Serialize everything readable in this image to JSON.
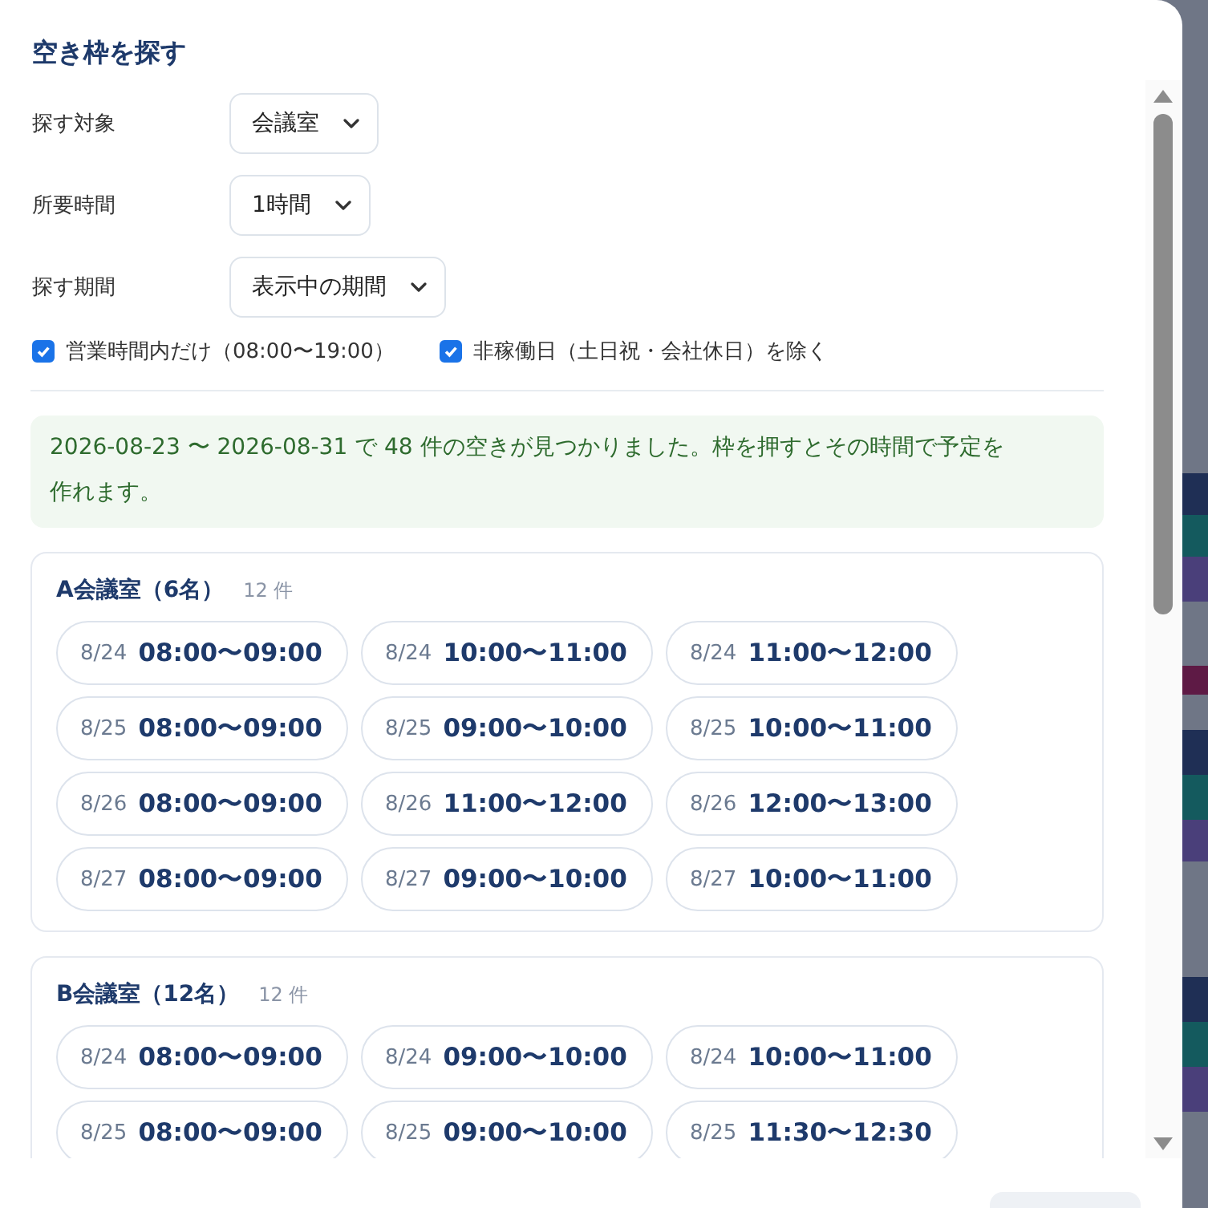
{
  "dialog": {
    "title": "空き枠を探す",
    "fields": [
      {
        "label": "探す対象",
        "value": "会議室"
      },
      {
        "label": "所要時間",
        "value": "1時間"
      },
      {
        "label": "探す期間",
        "value": "表示中の期間"
      }
    ],
    "checkboxes": [
      {
        "label": "営業時間内だけ（08:00〜19:00）",
        "checked": true
      },
      {
        "label": "非稼働日（土日祝・会社休日）を除く",
        "checked": true
      }
    ],
    "notice": "2026-08-23 〜 2026-08-31 で 48 件の空きが見つかりました。枠を押すとその時間で予定を作れます。",
    "groups": [
      {
        "name": "A会議室（6名）",
        "count": "12 件",
        "slots": [
          {
            "date": "8/24",
            "time": "08:00〜09:00"
          },
          {
            "date": "8/24",
            "time": "10:00〜11:00"
          },
          {
            "date": "8/24",
            "time": "11:00〜12:00"
          },
          {
            "date": "8/25",
            "time": "08:00〜09:00"
          },
          {
            "date": "8/25",
            "time": "09:00〜10:00"
          },
          {
            "date": "8/25",
            "time": "10:00〜11:00"
          },
          {
            "date": "8/26",
            "time": "08:00〜09:00"
          },
          {
            "date": "8/26",
            "time": "11:00〜12:00"
          },
          {
            "date": "8/26",
            "time": "12:00〜13:00"
          },
          {
            "date": "8/27",
            "time": "08:00〜09:00"
          },
          {
            "date": "8/27",
            "time": "09:00〜10:00"
          },
          {
            "date": "8/27",
            "time": "10:00〜11:00"
          }
        ]
      },
      {
        "name": "B会議室（12名）",
        "count": "12 件",
        "slots": [
          {
            "date": "8/24",
            "time": "08:00〜09:00"
          },
          {
            "date": "8/24",
            "time": "09:00〜10:00"
          },
          {
            "date": "8/24",
            "time": "10:00〜11:00"
          },
          {
            "date": "8/25",
            "time": "08:00〜09:00"
          },
          {
            "date": "8/25",
            "time": "09:00〜10:00"
          },
          {
            "date": "8/25",
            "time": "11:30〜12:30"
          }
        ]
      }
    ]
  }
}
